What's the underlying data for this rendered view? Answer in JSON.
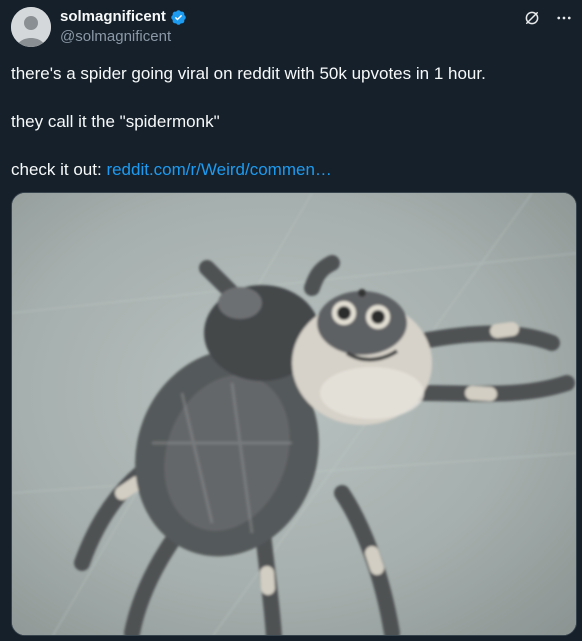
{
  "author": {
    "display_name": "solmagnificent",
    "handle": "@solmagnificent",
    "verified": true,
    "verified_color": "#1d9bf0"
  },
  "actions": {
    "grok_icon": "grok-icon",
    "more_icon": "more-icon"
  },
  "tweet": {
    "line1": "there's a spider going viral on reddit with 50k upvotes in 1 hour.",
    "line2": "they call it the \"spidermonk\"",
    "line3_prefix": "check it out: ",
    "link_text": "reddit.com/r/Weird/commen…"
  },
  "media": {
    "type": "image",
    "subject": "spider-photo"
  },
  "colors": {
    "background": "#15202b",
    "text": "#f7f9f9",
    "secondary": "#8b98a5",
    "link": "#1d9bf0"
  }
}
